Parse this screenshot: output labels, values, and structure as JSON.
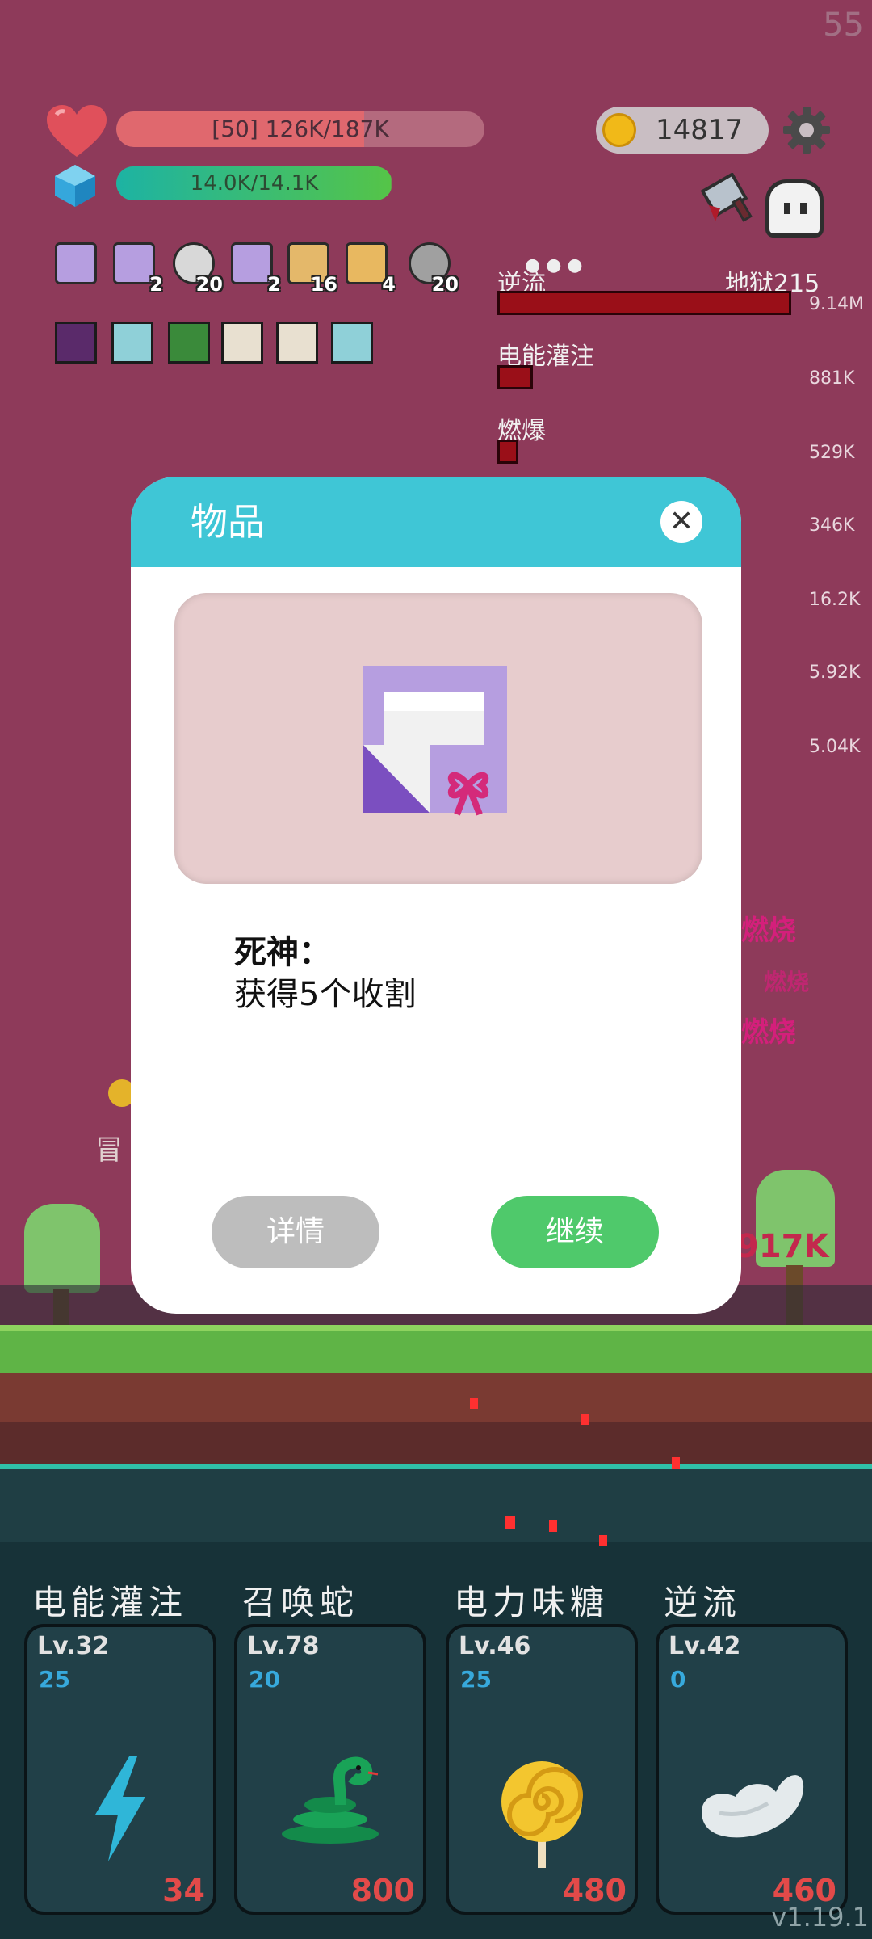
{
  "fps": "55",
  "hud": {
    "hp_text": "[50] 126K/187K",
    "hp_fraction": 0.674,
    "mp_text": "14.0K/14.1K",
    "mp_fraction": 0.993,
    "coins": "14817"
  },
  "inventory": [
    {
      "icon": "gift-card-icon",
      "count": ""
    },
    {
      "icon": "gift-card-icon",
      "count": "2"
    },
    {
      "icon": "hook-icon",
      "count": "20"
    },
    {
      "icon": "gift-card-icon",
      "count": "2"
    },
    {
      "icon": "scroll-icon",
      "count": "16"
    },
    {
      "icon": "map-icon",
      "count": "4"
    },
    {
      "icon": "orb-icon",
      "count": "20"
    }
  ],
  "skill_icons": [
    "demon-icon",
    "spark-icon",
    "leaf-icon",
    "burst-icon",
    "burst-icon",
    "spark-icon"
  ],
  "buffs": {
    "hell_label": "地狱215",
    "items": [
      {
        "label": "逆流",
        "fraction": 1.0
      },
      {
        "label": "电能灌注",
        "fraction": 0.12
      },
      {
        "label": "燃爆",
        "fraction": 0.07
      }
    ],
    "damage_list": [
      "9.14M",
      "881K",
      "529K",
      "346K",
      "16.2K",
      "5.92K",
      "5.04K"
    ]
  },
  "scene": {
    "burn_1": "燃烧",
    "burn_2": "燃烧",
    "burn_3": "燃烧",
    "hit_text": "917K",
    "side_text": "冒"
  },
  "dialog": {
    "title": "物品",
    "item_name": "死神：",
    "item_desc": "获得5个收割",
    "detail_button": "详情",
    "continue_button": "继续"
  },
  "skills": [
    {
      "name": "电能灌注",
      "level": "Lv.32",
      "mp": "25",
      "cost": "34",
      "icon": "lightning-icon"
    },
    {
      "name": "召唤蛇",
      "level": "Lv.78",
      "mp": "20",
      "cost": "800",
      "icon": "snake-icon"
    },
    {
      "name": "电力味糖",
      "level": "Lv.46",
      "mp": "25",
      "cost": "480",
      "icon": "lollipop-icon"
    },
    {
      "name": "逆流",
      "level": "Lv.42",
      "mp": "0",
      "cost": "460",
      "icon": "wing-icon"
    }
  ],
  "version": "v1.19.1",
  "colors": {
    "dialog_header": "#3fc6d6",
    "continue": "#4fc96b",
    "detail": "#bdbdbd",
    "background": "#8e3a5a"
  }
}
